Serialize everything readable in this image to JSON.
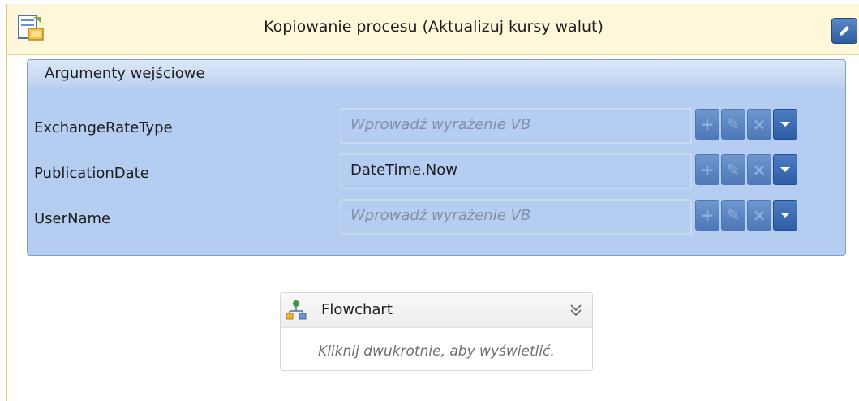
{
  "activity": {
    "title": "Kopiowanie procesu (Aktualizuj kursy walut)"
  },
  "arguments": {
    "header": "Argumenty wejściowe",
    "rows": [
      {
        "name": "ExchangeRateType",
        "value": "",
        "placeholder": "Wprowadź wyrażenie VB"
      },
      {
        "name": "PublicationDate",
        "value": "DateTime.Now",
        "placeholder": ""
      },
      {
        "name": "UserName",
        "value": "",
        "placeholder": "Wprowadź wyrażenie VB"
      }
    ],
    "row_buttons": {
      "add": "+",
      "edit": "✎",
      "remove": "×",
      "dropdown": "▾"
    }
  },
  "flowchart": {
    "title": "Flowchart",
    "hint": "Kliknij dwukrotnie, aby wyświetlić."
  },
  "colors": {
    "header_bg": "#fff7d9",
    "panel_bg": "#b5cdf1",
    "button_blue": "#2e5d9f"
  }
}
